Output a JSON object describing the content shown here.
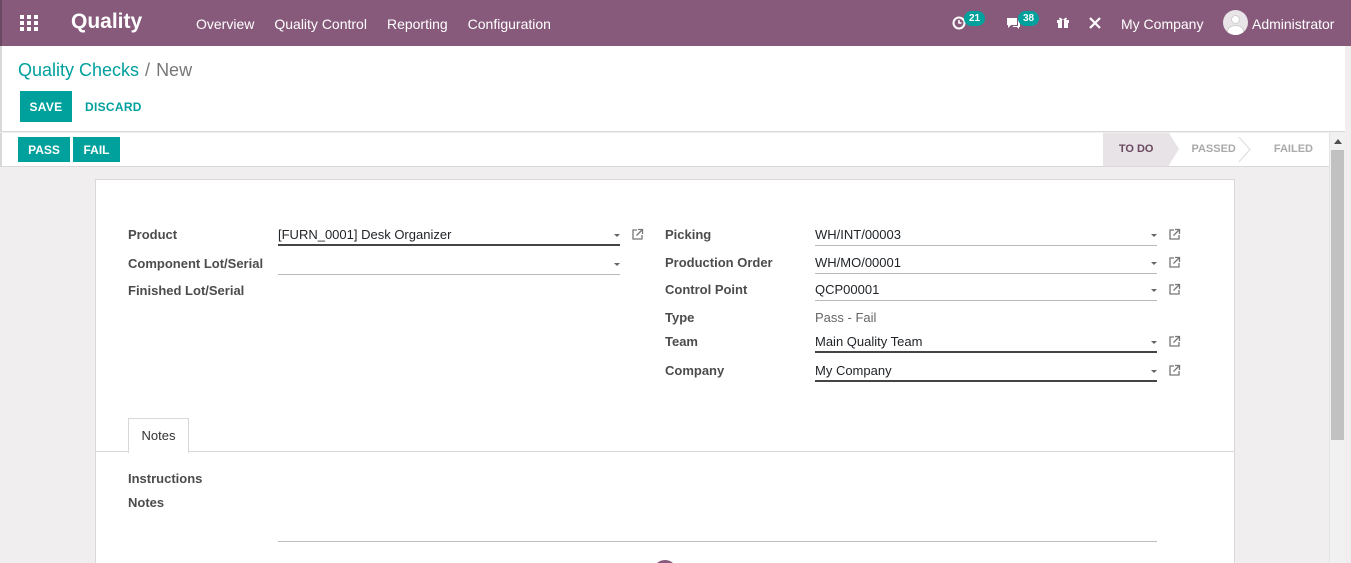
{
  "navbar": {
    "app_name": "Quality",
    "menu": [
      "Overview",
      "Quality Control",
      "Reporting",
      "Configuration"
    ],
    "activity_count": "21",
    "message_count": "38",
    "company": "My Company",
    "user": "Administrator"
  },
  "breadcrumb": {
    "parent": "Quality Checks",
    "separator": "/",
    "current": "New"
  },
  "actions": {
    "save": "SAVE",
    "discard": "DISCARD"
  },
  "statusbar": {
    "pass": "PASS",
    "fail": "FAIL",
    "stages": [
      "TO DO",
      "PASSED",
      "FAILED"
    ],
    "active_stage": "TO DO"
  },
  "form": {
    "product_label": "Product",
    "product_value": "[FURN_0001] Desk Organizer",
    "component_lot_label": "Component Lot/Serial",
    "component_lot_value": "",
    "finished_lot_label": "Finished Lot/Serial",
    "picking_label": "Picking",
    "picking_value": "WH/INT/00003",
    "production_order_label": "Production Order",
    "production_order_value": "WH/MO/00001",
    "control_point_label": "Control Point",
    "control_point_value": "QCP00001",
    "type_label": "Type",
    "type_value": "Pass - Fail",
    "team_label": "Team",
    "team_value": "Main Quality Team",
    "company_label": "Company",
    "company_value": "My Company"
  },
  "tabs": {
    "notes_tab": "Notes",
    "instructions_label": "Instructions",
    "notes_label": "Notes"
  },
  "colors": {
    "brand": "#875a7b",
    "accent": "#00a09d"
  }
}
